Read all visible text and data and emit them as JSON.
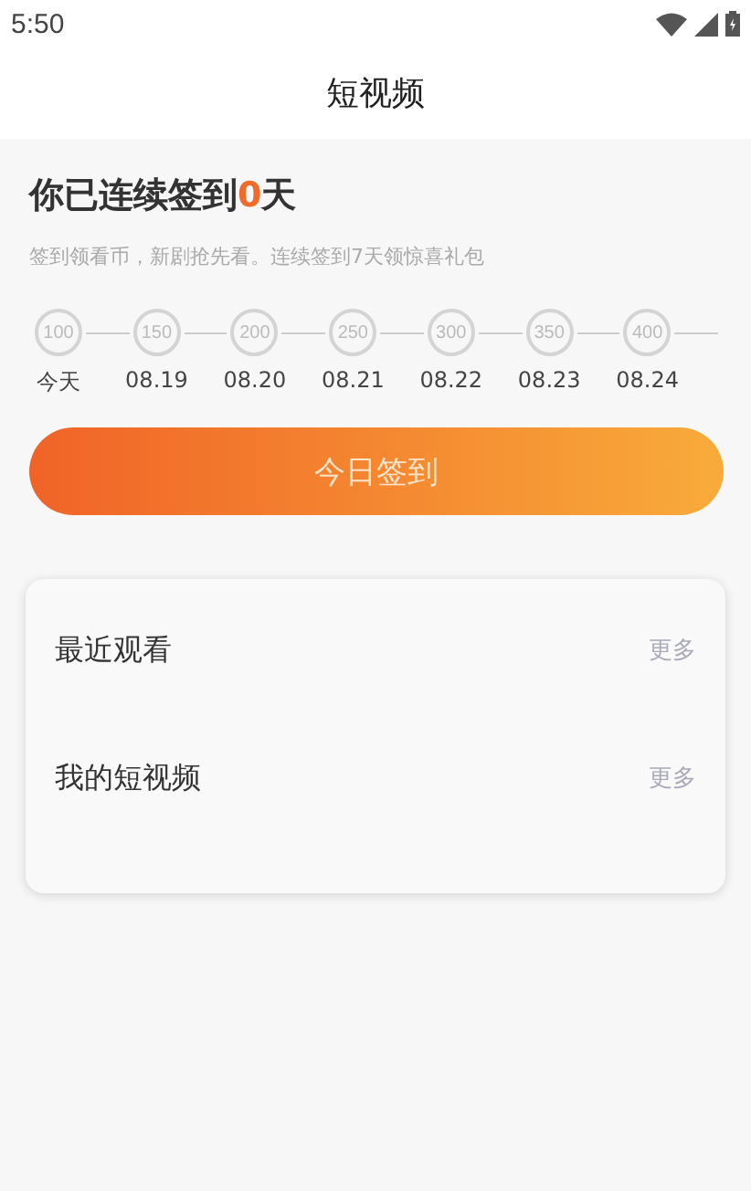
{
  "status_bar": {
    "time": "5:50"
  },
  "header": {
    "title": "短视频"
  },
  "checkin": {
    "title_before": "你已连续签到",
    "streak": "0",
    "title_after": "天",
    "subtitle": "签到领看币，新剧抢先看。连续签到7天领惊喜礼包",
    "days": [
      {
        "coins": "100",
        "date": "今天",
        "signed": false
      },
      {
        "coins": "150",
        "date": "08.19",
        "signed": false
      },
      {
        "coins": "200",
        "date": "08.20",
        "signed": false
      },
      {
        "coins": "250",
        "date": "08.21",
        "signed": false
      },
      {
        "coins": "300",
        "date": "08.22",
        "signed": false
      },
      {
        "coins": "350",
        "date": "08.23",
        "signed": false
      },
      {
        "coins": "400",
        "date": "08.24",
        "signed": false
      }
    ],
    "button": "今日签到"
  },
  "sections": [
    {
      "title": "最近观看",
      "more": "更多"
    },
    {
      "title": "我的短视频",
      "more": "更多"
    }
  ]
}
